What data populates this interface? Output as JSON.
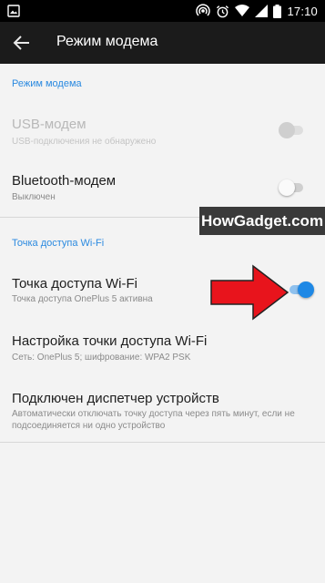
{
  "status_bar": {
    "time": "17:10",
    "icons": [
      "image-icon",
      "hotspot-icon",
      "alarm-icon",
      "wifi-icon",
      "signal-icon",
      "battery-icon"
    ]
  },
  "toolbar": {
    "title": "Режим модема",
    "back_icon": "arrow-back-icon"
  },
  "sections": {
    "modem": {
      "header": "Режим модема"
    },
    "hotspot": {
      "header": "Точка доступа Wi-Fi"
    }
  },
  "items": {
    "usb": {
      "title": "USB-модем",
      "subtitle": "USB-подключения не обнаружено",
      "switch_on": false,
      "enabled": false
    },
    "bluetooth": {
      "title": "Bluetooth-модем",
      "subtitle": "Выключен",
      "switch_on": false,
      "enabled": true
    },
    "wifi_hotspot": {
      "title": "Точка доступа Wi-Fi",
      "subtitle": "Точка доступа OnePlus 5 активна",
      "switch_on": true,
      "enabled": true
    },
    "wifi_settings": {
      "title": "Настройка точки доступа Wi-Fi",
      "subtitle": "Сеть: OnePlus 5; шифрование: WPA2 PSK"
    },
    "device_manager": {
      "title": "Подключен диспетчер устройств",
      "subtitle": "Автоматически отключать точку доступа через пять минут, если не подсоединяется ни одно устройство"
    }
  },
  "watermark": {
    "text": "HowGadget.com"
  },
  "colors": {
    "accent": "#1e88e5",
    "section_header": "#2b8ae0",
    "toolbar": "#1b1b1b",
    "background": "#f3f3f3",
    "annotation_arrow": "#e8141c"
  }
}
